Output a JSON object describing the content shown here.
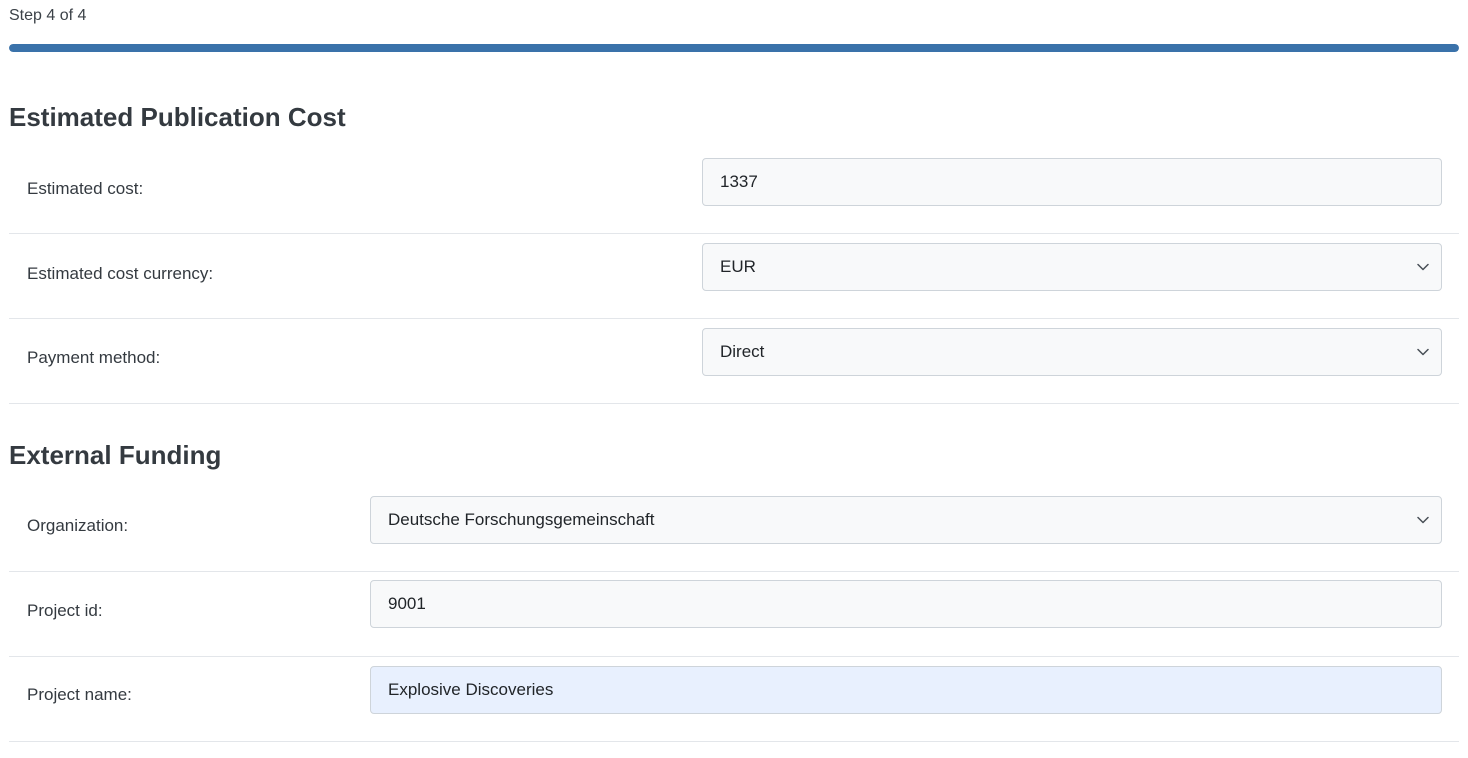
{
  "step": {
    "label": "Step 4 of 4",
    "progress_percent": 100,
    "color": "#3a72aa"
  },
  "estimated_cost_section": {
    "title": "Estimated Publication Cost",
    "fields": {
      "cost": {
        "label": "Estimated cost:",
        "value": "1337"
      },
      "currency": {
        "label": "Estimated cost currency:",
        "value": "EUR",
        "icon": "chevron-down-icon"
      },
      "payment_method": {
        "label": "Payment method:",
        "value": "Direct",
        "icon": "chevron-down-icon"
      }
    }
  },
  "external_funding_section": {
    "title": "External Funding",
    "fields": {
      "organization": {
        "label": "Organization:",
        "value": "Deutsche Forschungsgemeinschaft",
        "icon": "chevron-down-icon"
      },
      "project_id": {
        "label": "Project id:",
        "value": "9001"
      },
      "project_name": {
        "label": "Project name:",
        "value": "Explosive Discoveries",
        "highlight_color": "#e8f0fe"
      }
    }
  }
}
